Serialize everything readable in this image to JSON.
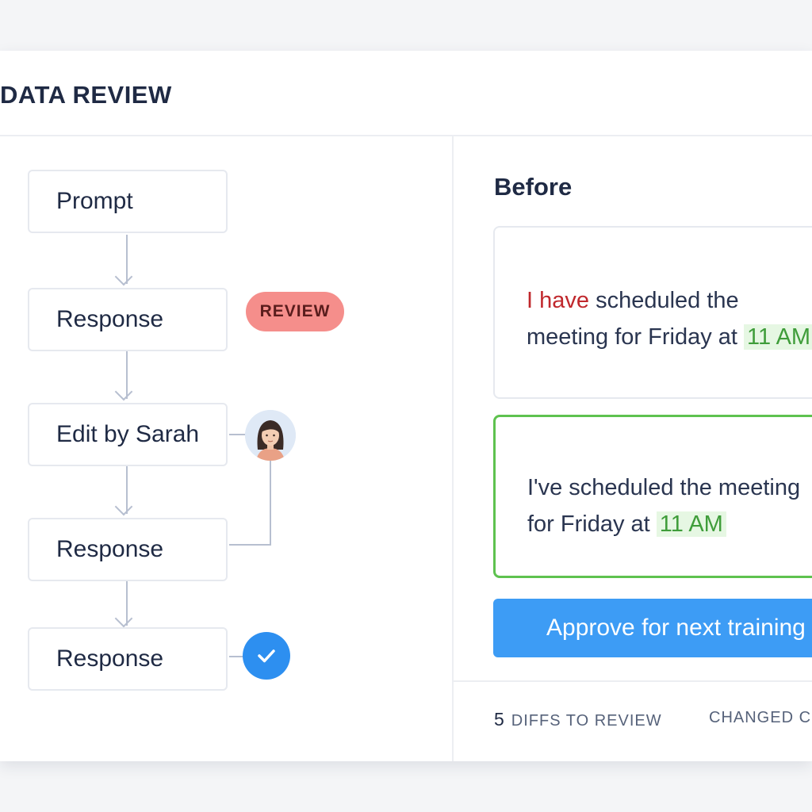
{
  "app": {
    "title": "DATA REVIEW"
  },
  "flow": {
    "nodes": [
      {
        "label": "Prompt"
      },
      {
        "label": "Response"
      },
      {
        "label": "Edit by Sarah"
      },
      {
        "label": "Response"
      },
      {
        "label": "Response"
      }
    ],
    "review_badge": "REVIEW",
    "avatar_icon": "woman-avatar-icon",
    "check_icon": "checkmark-icon"
  },
  "diff": {
    "section_title": "Before",
    "before": {
      "removed": "have",
      "line1_rest": "scheduled the",
      "line2_prefix": "meeting for Friday at",
      "line2_added": "11 AM"
    },
    "after": {
      "line1": "I've scheduled the meeting",
      "line2_prefix": "for Friday at",
      "line2_added": "11 AM"
    },
    "approve_label": "Approve for next training"
  },
  "footer": {
    "diffs_count": "5",
    "diffs_label": "DIFFS TO REVIEW",
    "changed_label": "CHANGED C"
  },
  "colors": {
    "accent": "#3d9cf5",
    "added_text": "#3f9d3a",
    "removed_text": "#c0282d",
    "review_badge": "#f58e8b",
    "success_border": "#5ec24f"
  }
}
